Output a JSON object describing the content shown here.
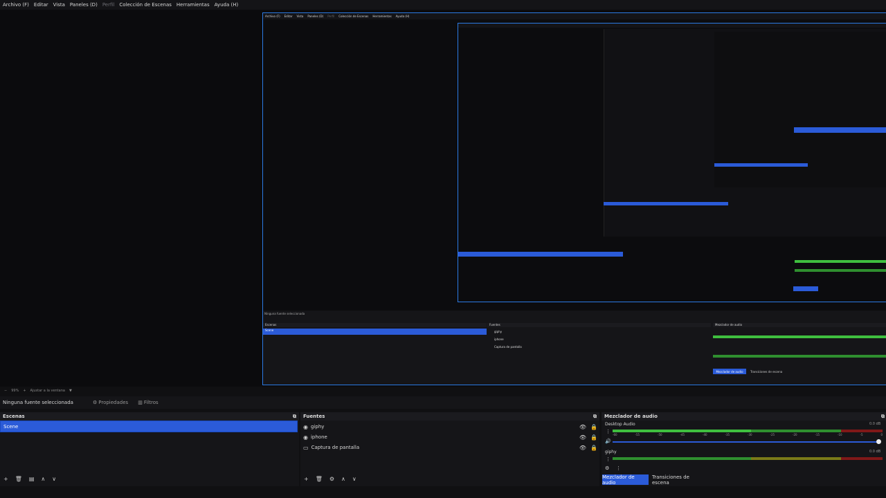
{
  "menu": {
    "items": [
      "Archivo (F)",
      "Editar",
      "Vista",
      "Paneles (D)",
      "Perfil",
      "Colección de Escenas",
      "Herramientas",
      "Ayuda (H)"
    ]
  },
  "zoom": {
    "level": "99%",
    "fit_label": "Ajustar a la ventana"
  },
  "toolbar": {
    "no_source": "Ninguna fuente seleccionada",
    "properties_label": "Propiedades",
    "filters_label": "Filtros"
  },
  "scenes": {
    "header": "Escenas",
    "items": [
      "Scene"
    ]
  },
  "sources": {
    "header": "Fuentes",
    "items": [
      {
        "name": "giphy",
        "icon": "image-icon"
      },
      {
        "name": "iphone",
        "icon": "image-icon"
      },
      {
        "name": "Captura de pantalla",
        "icon": "monitor-icon"
      }
    ]
  },
  "mixer": {
    "header": "Mezclador de audio",
    "channels": [
      {
        "name": "Desktop Audio",
        "db": "0.0 dB"
      },
      {
        "name": "giphy",
        "db": "0.0 dB"
      }
    ],
    "ticks": [
      "-60",
      "-55",
      "-50",
      "-45",
      "-40",
      "-35",
      "-30",
      "-25",
      "-20",
      "-15",
      "-10",
      "-5",
      "0"
    ],
    "tab_mixer": "Mezclador de audio",
    "tab_transitions": "Transiciones de escena"
  },
  "colors": {
    "accent": "#2b5bd8",
    "meter_green": "#3fbf3f",
    "meter_yellow": "#a0a020",
    "meter_red": "#c02020"
  }
}
